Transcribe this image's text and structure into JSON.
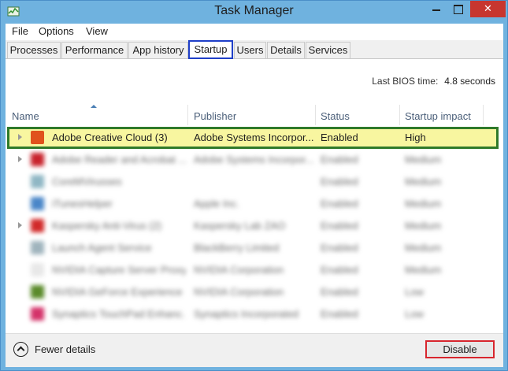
{
  "window": {
    "title": "Task Manager",
    "close_glyph": "✕",
    "icon": "task-manager-icon"
  },
  "menu": [
    "File",
    "Options",
    "View"
  ],
  "tabs": [
    {
      "label": "Processes",
      "active": false
    },
    {
      "label": "Performance",
      "active": false
    },
    {
      "label": "App history",
      "active": false
    },
    {
      "label": "Startup",
      "active": true
    },
    {
      "label": "Users",
      "active": false
    },
    {
      "label": "Details",
      "active": false
    },
    {
      "label": "Services",
      "active": false
    }
  ],
  "bios": {
    "label": "Last BIOS time:",
    "value": "4.8 seconds"
  },
  "columns": [
    "Name",
    "Publisher",
    "Status",
    "Startup impact"
  ],
  "rows": [
    {
      "name": "Adobe Creative Cloud (3)",
      "publisher": "Adobe Systems Incorpor...",
      "status": "Enabled",
      "impact": "High",
      "expandable": true,
      "icon_color": "#e0521c",
      "selected": true
    },
    {
      "name": "Adobe Reader and Acrobat ...",
      "publisher": "Adobe Systems Incorpor...",
      "status": "Enabled",
      "impact": "Medium",
      "expandable": true,
      "icon_color": "#c8232c",
      "selected": false
    },
    {
      "name": "CoreMVirusses",
      "publisher": "",
      "status": "Enabled",
      "impact": "Medium",
      "expandable": false,
      "icon_color": "#8fb7c4",
      "selected": false
    },
    {
      "name": "iTunesHelper",
      "publisher": "Apple Inc.",
      "status": "Enabled",
      "impact": "Medium",
      "expandable": false,
      "icon_color": "#4a86c8",
      "selected": false
    },
    {
      "name": "Kaspersky Anti-Virus (2)",
      "publisher": "Kaspersky Lab ZAO",
      "status": "Enabled",
      "impact": "Medium",
      "expandable": true,
      "icon_color": "#d12a2a",
      "selected": false
    },
    {
      "name": "Launch Agent Service",
      "publisher": "BlackBerry Limited",
      "status": "Enabled",
      "impact": "Medium",
      "expandable": false,
      "icon_color": "#9fb4bd",
      "selected": false
    },
    {
      "name": "NVIDIA Capture Server Proxy",
      "publisher": "NVIDIA Corporation",
      "status": "Enabled",
      "impact": "Medium",
      "expandable": false,
      "icon_color": "#e8e8e8",
      "selected": false
    },
    {
      "name": "NVIDIA GeForce Experience ...",
      "publisher": "NVIDIA Corporation",
      "status": "Enabled",
      "impact": "Low",
      "expandable": false,
      "icon_color": "#5a8a2a",
      "selected": false
    },
    {
      "name": "Synaptics TouchPad Enhanc...",
      "publisher": "Synaptics Incorporated",
      "status": "Enabled",
      "impact": "Low",
      "expandable": false,
      "icon_color": "#d4336a",
      "selected": false
    }
  ],
  "footer": {
    "fewer_details": "Fewer details",
    "disable": "Disable"
  }
}
